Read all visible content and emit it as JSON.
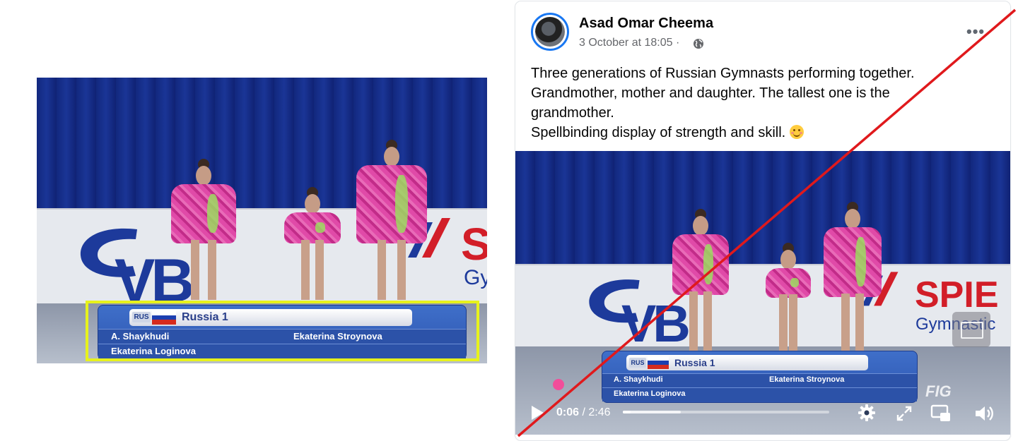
{
  "left_image": {
    "banner": {
      "logo": "VB",
      "red_text": "S",
      "grey_text": "Gy"
    },
    "lower_third": {
      "country_code": "RUS",
      "team": "Russia  1",
      "athletes": [
        "A. Shaykhudi",
        "Ekaterina Stroynova",
        "Ekaterina Loginova"
      ]
    },
    "highlight_color": "#e7f21c"
  },
  "post": {
    "author": "Asad Omar Cheema",
    "timestamp": "3 October at 18:05 · ",
    "text_lines": [
      "Three generations of Russian Gymnasts performing together.",
      "Grandmother, mother and daughter. The tallest one is the",
      "grandmother.",
      "Spellbinding display of strength and skill."
    ],
    "more_label": "•••",
    "video": {
      "banner": {
        "logo": "VB",
        "red_text": "SPIE",
        "grey_text": "Gymnastic"
      },
      "lower_third": {
        "country_code": "RUS",
        "team": "Russia  1",
        "athletes": [
          "A. Shaykhudi",
          "Ekaterina Stroynova",
          "Ekaterina Loginova"
        ]
      },
      "watermark": "FIG",
      "current_time": "0:06",
      "duration": " / 2:46",
      "progress_played": 0.036,
      "progress_buffered": 0.28
    }
  },
  "strike_line_color": "#e0191c"
}
